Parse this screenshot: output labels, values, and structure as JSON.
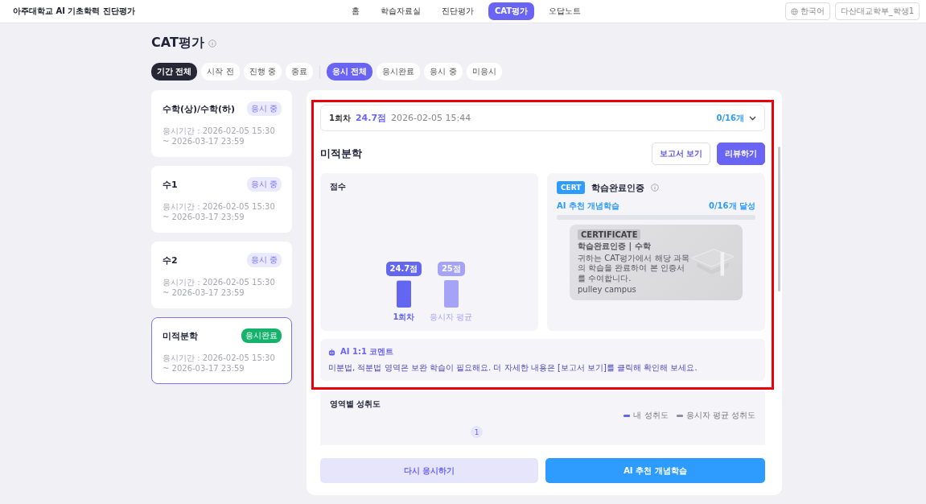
{
  "header": {
    "title": "아주대학교 AI 기초학력 진단평가",
    "language": "한국어",
    "user": "다산대교학부_학생1",
    "nav": [
      {
        "label": "홈",
        "selected": false
      },
      {
        "label": "학습자료실",
        "selected": false
      },
      {
        "label": "진단평가",
        "selected": false
      },
      {
        "label": "CAT평가",
        "selected": true
      },
      {
        "label": "오답노트",
        "selected": false
      }
    ]
  },
  "page": {
    "title": "CAT평가"
  },
  "period_filters": [
    {
      "label": "기간 전체",
      "selected": true
    },
    {
      "label": "시작 전",
      "selected": false
    },
    {
      "label": "진행 중",
      "selected": false
    },
    {
      "label": "종료",
      "selected": false
    }
  ],
  "status_filters": [
    {
      "label": "응시 전체",
      "selected": true
    },
    {
      "label": "응시완료",
      "selected": false
    },
    {
      "label": "응시 중",
      "selected": false
    },
    {
      "label": "미응시",
      "selected": false
    }
  ],
  "exams": [
    {
      "name": "수학(상)/수학(하)",
      "status": "응시 중",
      "kind": "in_progress",
      "period": "응시기간 : 2026-02-05 15:30 ~ 2026-03-17 23:59",
      "selected": false
    },
    {
      "name": "수1",
      "status": "응시 중",
      "kind": "in_progress",
      "period": "응시기간 : 2026-02-05 15:30 ~ 2026-03-17 23:59",
      "selected": false
    },
    {
      "name": "수2",
      "status": "응시 중",
      "kind": "in_progress",
      "period": "응시기간 : 2026-02-05 15:30 ~ 2026-03-17 23:59",
      "selected": false
    },
    {
      "name": "미적분학",
      "status": "응시완료",
      "kind": "done",
      "period": "응시기간 : 2026-02-05 15:30 ~ 2026-03-17 23:59",
      "selected": true
    }
  ],
  "attempt": {
    "round": "1회차",
    "score": "24.7점",
    "date": "2026-02-05 15:44",
    "progress": "0/16개",
    "expanded": false
  },
  "detail": {
    "title": "미적분학",
    "report_button": "보고서 보기",
    "review_button": "리뷰하기"
  },
  "score_panel": {
    "title": "점수",
    "chart_data": {
      "type": "bar",
      "categories": [
        "1회차",
        "응시자 평균"
      ],
      "values": [
        24.7,
        25
      ],
      "value_labels": [
        "24.7점",
        "25점"
      ]
    }
  },
  "certificate": {
    "badge": "CERT",
    "title": "학습완료인증",
    "track_label": "AI 추천 개념학습",
    "track_reading": "0/16개 달성",
    "level": 0,
    "card": {
      "tag": "CERTIFICATE",
      "heading": "학습완료인증 | 수학",
      "body": "귀하는 CAT평가에서 해당 과목의 학습을 완료하여 본 인증서를 수여합니다.",
      "brand": "pulley campus"
    }
  },
  "comment": {
    "title": "AI 1:1 코멘트",
    "text": "미분법, 적분법 영역은 보완 학습이 필요해요. 더 자세한 내용은 [보고서 보기]를 클릭해 확인해 보세요."
  },
  "achievement": {
    "title": "영역별 성취도",
    "page": "1",
    "legend": [
      {
        "label": "내 성취도",
        "color": "#6366f1"
      },
      {
        "label": "응시자 평균 성취도",
        "color": "#8e8ea8"
      }
    ]
  },
  "actions": [
    {
      "label": "다시 응시하기",
      "kind": "secondary"
    },
    {
      "label": "AI 추천 개념학습",
      "kind": "primary"
    }
  ]
}
